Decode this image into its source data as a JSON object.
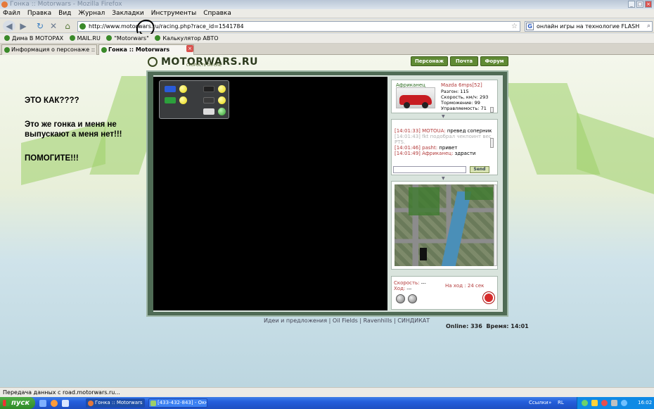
{
  "window": {
    "title": "Гонка :: Motorwars - Mozilla Firefox"
  },
  "menu": [
    "Файл",
    "Правка",
    "Вид",
    "Журнал",
    "Закладки",
    "Инструменты",
    "Справка"
  ],
  "address": {
    "url": "http://www.motorwars.ru/racing.php?race_id=1541784"
  },
  "search": {
    "text": "онлайн игры на технологие FLASH",
    "engine_glyph": "G"
  },
  "bookmarks": [
    "Дима В МОТОРАХ",
    "MAIL.RU",
    "\"Motorwars\"",
    "Калькулятор АВТО"
  ],
  "tabs": [
    {
      "label": "Информация о персонаже :: \"Motorw...",
      "active": false
    },
    {
      "label": "Гонка :: Motorwars",
      "active": true
    }
  ],
  "site": {
    "logo": "MOTORWARS.RU",
    "tagline": "СКОРОСТЬ ON-LINE",
    "nav": [
      "Персонаж",
      "Почта",
      "Форум"
    ]
  },
  "overlay_text": [
    "ЭТО КАК????",
    "Это же гонка и меня не",
    "выпускают а меня нет!!!",
    "ПОМОГИТЕ!!!"
  ],
  "player": {
    "name": "Африканец",
    "car": "Mazda 6mps[52]",
    "stats": [
      {
        "label": "Разгон:",
        "value": "115"
      },
      {
        "label": "Скорость, км/ч:",
        "value": "293"
      },
      {
        "label": "Торможение:",
        "value": "99"
      },
      {
        "label": "Управляемость:",
        "value": "71"
      }
    ]
  },
  "chat": {
    "messages": [
      {
        "time": "[14:01:33]",
        "nick": "MOTOUA:",
        "text": "превед соперник!",
        "faded": false
      },
      {
        "time": "[14:01:43]",
        "nick": "",
        "text": "fkt подобрал чекпоинт весом 4",
        "faded": true
      },
      {
        "time": "",
        "nick": "",
        "text": "PTS.",
        "faded": true
      },
      {
        "time": "[14:01:46]",
        "nick": "pasht:",
        "text": "привет",
        "faded": false
      },
      {
        "time": "[14:01:49]",
        "nick": "Африканец:",
        "text": "здрасти",
        "faded": false
      }
    ],
    "input_value": "",
    "send_label": "Send"
  },
  "race_status": {
    "speed_label": "Скорость:",
    "speed_value": "---",
    "move_label": "Ход:",
    "move_value": "---",
    "turn_label": "На ход :",
    "turn_value": "24 сек"
  },
  "footer": {
    "links": [
      "Идеи и предложения",
      "Oil Fields",
      "Ravenhills",
      "СИНДИКАТ"
    ],
    "separator": "|",
    "online": "Online: 336",
    "time": "Время: 14:01"
  },
  "statusbar": "Передача данных с road.motorwars.ru...",
  "taskbar": {
    "start": "пуск",
    "tasks": [
      {
        "label": "Гонка :: Motorwars ...",
        "active": true
      },
      {
        "label": "[433-432-843] - Окн...",
        "active": false
      }
    ],
    "links": "Ссылки",
    "lang": "RL",
    "clock": "16:02"
  },
  "colors": {
    "accent": "#5f8a34",
    "frame": "#4f6b55",
    "label_red": "#b23a3a"
  }
}
